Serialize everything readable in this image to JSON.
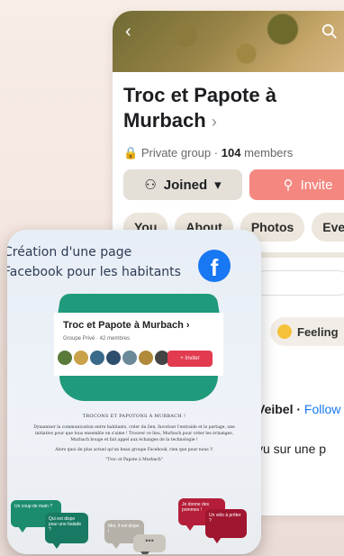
{
  "group": {
    "name": "Troc et Papote à Murbach",
    "chevron": "›",
    "privacy": "Private group",
    "separator": "·",
    "member_count": "104",
    "members_label": "members",
    "joined_label": "Joined",
    "invite_label": "Invite",
    "tabs": [
      "You",
      "About",
      "Photos",
      "Even"
    ]
  },
  "composer": {
    "feeling_label": "Feeling"
  },
  "post": {
    "author": "Veibel",
    "separator": " · ",
    "follow_label": "Follow",
    "text": "vu sur une p"
  },
  "poster": {
    "title": "Création d'une page Facebook pour les habitants",
    "fb_letter": "f",
    "card_title": "Troc et Papote à Murbach ›",
    "card_meta": "Groupe Privé · 42 membres",
    "card_invite": "+ Inviter",
    "body_heading": "TROCONS ET PAPOTONS À MURBACH !",
    "body_p1": "Dynamiser la communication entre habitants, créer du lien, favoriser l'entraide et le partage, une initiative pour que tous ensemble on s'aime ! Trouver ce lieu, Murbach pour créer les échanges. Murbach bouge et fait appel aux échanges de la technologie !",
    "body_p2": "Alors quoi de plus actuel qu'un beau groupe Facebook, rien que pour nous !!",
    "body_p3": "\"Troc et Papote à Murbach\"",
    "bubble_green1": "Un coup de main ?",
    "bubble_green2": "Qui est dispo pour une balade ?",
    "bubble_gray1": "Moi, il est dispo !",
    "bubble_gray2": "•••",
    "bubble_red1": "Je donne des pommes !",
    "bubble_red2": "Un vélo à prêter ?"
  },
  "colors": {
    "invite_bg": "#f4877f",
    "joined_bg": "#e4e0d8",
    "facebook_blue": "#1877f2",
    "poster_green": "#1f9a7a",
    "poster_red": "#b51e3a"
  }
}
